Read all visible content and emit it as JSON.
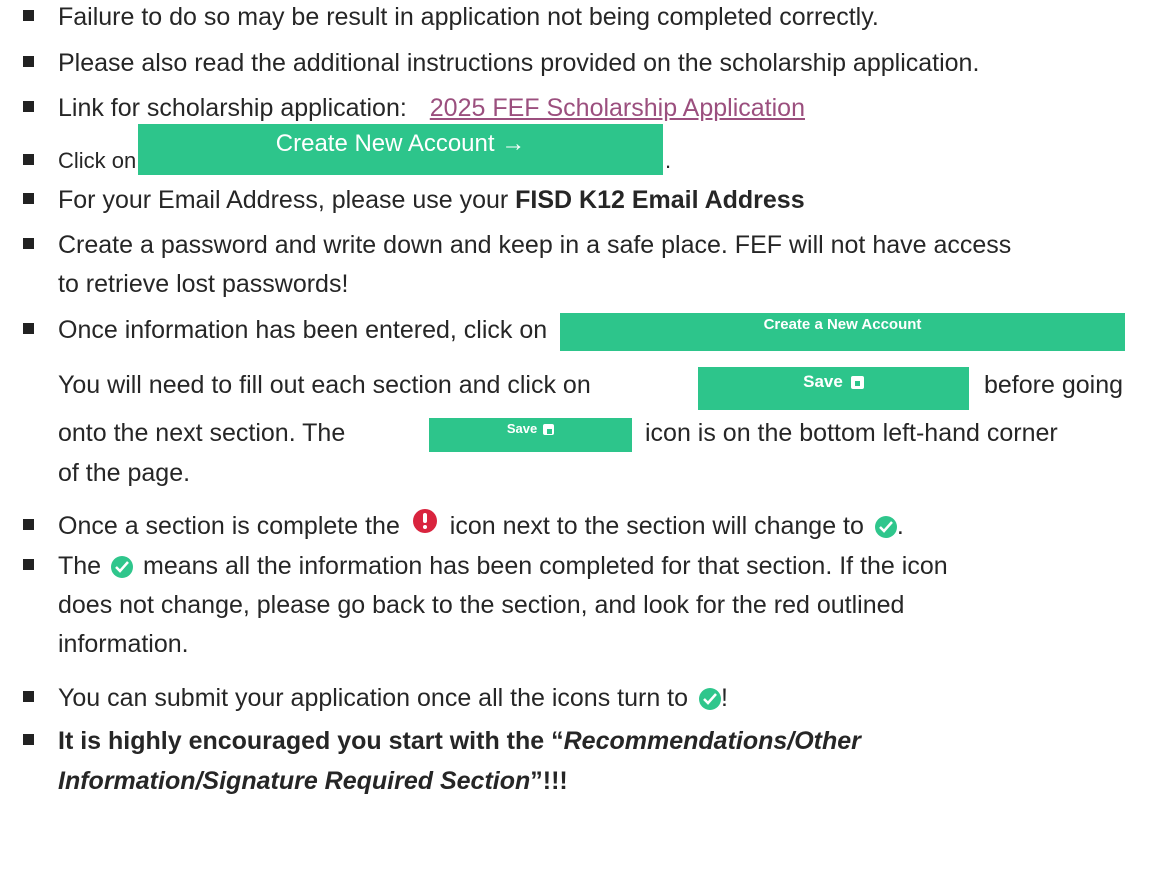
{
  "items": {
    "failure": "Failure to do so may be result in application not being completed correctly.",
    "additional": "Please also read the additional instructions provided on the scholarship application.",
    "link_prefix": "Link for scholarship application:",
    "link_text": "2025 FEF Scholarship Application",
    "click_on": "Click on",
    "period": ".",
    "email_prefix": "For your Email Address, please use your ",
    "email_bold": "FISD K12 Email Address",
    "password_line1": "Create a password and write down and keep in a safe place. FEF will not have access",
    "password_line2": "to retrieve lost passwords!",
    "once_info": "Once information has been entered, click on",
    "fill_prefix": "You will need to fill out each section and click on",
    "fill_suffix": "before going",
    "next_prefix": "onto the next section. The",
    "next_suffix": "icon is on the bottom left-hand corner",
    "of_page": "of the page.",
    "complete_prefix": "Once a section is complete the",
    "complete_mid": "icon next to the section will change to",
    "complete_end": ".",
    "the": "The",
    "means_line1": "means all the information has been completed for that section. If the icon",
    "means_line2": "does not change, please go back to the section, and look for the red outlined",
    "means_line3": "information.",
    "submit_prefix": "You can submit your application once all the icons turn to",
    "submit_end": "!",
    "encourage_prefix": "It is highly encouraged you start with the “",
    "encourage_italic1": "Recommendations/Other",
    "encourage_italic2": "Information/Signature Required Section",
    "encourage_suffix": "”!!!"
  },
  "buttons": {
    "create_new_account_arrow": "Create New Account →",
    "create_a_new_account": "Create a New Account",
    "save_large": "Save",
    "save_small": "Save"
  },
  "colors": {
    "accent": "#2dc58b",
    "link": "#9b4f7e",
    "error": "#d9243e"
  }
}
